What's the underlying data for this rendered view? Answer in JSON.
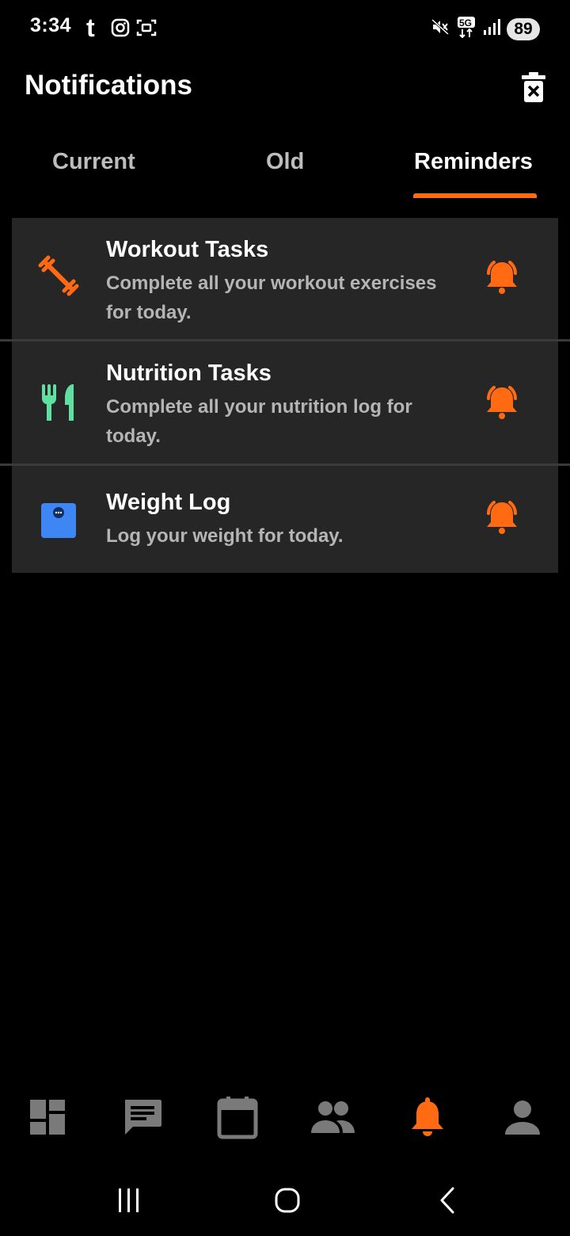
{
  "status_bar": {
    "time": "3:34",
    "left_icons": [
      "tumblr-icon",
      "instagram-icon",
      "screenshot-icon"
    ],
    "right_icons": [
      "mute-icon",
      "5g-icon",
      "signal-icon"
    ],
    "battery": "89"
  },
  "header": {
    "title": "Notifications",
    "action_icon": "delete-icon"
  },
  "tabs": [
    {
      "label": "Current",
      "active": false
    },
    {
      "label": "Old",
      "active": false
    },
    {
      "label": "Reminders",
      "active": true
    }
  ],
  "reminders": [
    {
      "icon": "dumbbell-icon",
      "title": "Workout Tasks",
      "description": "Complete all your workout exercises for today.",
      "color": "#ff6a13"
    },
    {
      "icon": "fork-knife-icon",
      "title": "Nutrition Tasks",
      "description": "Complete all your nutrition log for today.",
      "color": "#5fe0a0"
    },
    {
      "icon": "scale-icon",
      "title": "Weight Log",
      "description": "Log your weight for today.",
      "color": "#3f86f5"
    }
  ],
  "bottom_nav": [
    {
      "icon": "dashboard-icon",
      "active": false
    },
    {
      "icon": "chat-icon",
      "active": false
    },
    {
      "icon": "calendar-icon",
      "active": false
    },
    {
      "icon": "people-icon",
      "active": false
    },
    {
      "icon": "bell-icon",
      "active": true
    },
    {
      "icon": "profile-icon",
      "active": false
    }
  ],
  "colors": {
    "accent": "#ff6a13",
    "background": "#000000",
    "card": "#262626",
    "inactive": "#7a7a7a"
  },
  "system_nav": [
    "recents-icon",
    "home-icon",
    "back-icon"
  ]
}
